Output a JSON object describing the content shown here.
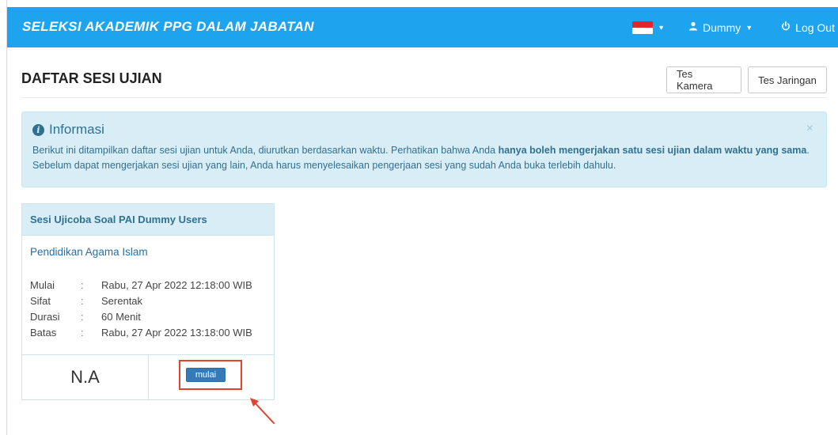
{
  "navbar": {
    "brand": "SELEKSI AKADEMIK PPG DALAM JABATAN",
    "language_icon": "indonesia-flag",
    "user_label": "Dummy",
    "user_icon": "user-icon",
    "logout_label": "Log Out",
    "logout_icon": "power-icon",
    "bg_color": "#1ea3ef"
  },
  "header": {
    "title": "DAFTAR SESI UJIAN",
    "camera_test_label": "Tes Kamera",
    "network_test_label": "Tes Jaringan"
  },
  "alert": {
    "title": "Informasi",
    "close_label": "×",
    "text_before": "Berikut ini ditampilkan daftar sesi ujian untuk Anda, diurutkan berdasarkan waktu. Perhatikan bahwa Anda ",
    "text_bold": "hanya boleh mengerjakan satu sesi ujian dalam waktu yang sama",
    "text_after": ". Sebelum dapat mengerjakan sesi ujian yang lain, Anda harus menyelesaikan pengerjaan sesi yang sudah Anda buka terlebih dahulu."
  },
  "session": {
    "name": "Sesi Ujicoba Soal PAI Dummy Users",
    "subject": "Pendidikan Agama Islam",
    "rows": [
      {
        "key": "Mulai",
        "sep": ":",
        "value": "Rabu, 27 Apr 2022 12:18:00 WIB"
      },
      {
        "key": "Sifat",
        "sep": ":",
        "value": "Serentak"
      },
      {
        "key": "Durasi",
        "sep": ":",
        "value": "60 Menit"
      },
      {
        "key": "Batas",
        "sep": ":",
        "value": "Rabu, 27 Apr 2022 13:18:00 WIB"
      }
    ],
    "score": "N.A",
    "start_label": "mulai"
  },
  "colors": {
    "highlight": "#e2432b",
    "alert_bg": "#d9edf7",
    "primary": "#337ab7"
  }
}
